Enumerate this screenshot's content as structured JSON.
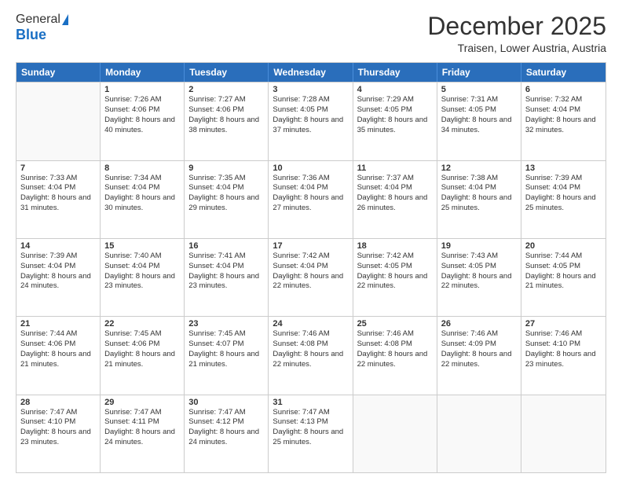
{
  "logo": {
    "general": "General",
    "blue": "Blue"
  },
  "header": {
    "month": "December 2025",
    "location": "Traisen, Lower Austria, Austria"
  },
  "weekdays": [
    "Sunday",
    "Monday",
    "Tuesday",
    "Wednesday",
    "Thursday",
    "Friday",
    "Saturday"
  ],
  "weeks": [
    [
      {
        "day": "",
        "empty": true
      },
      {
        "day": "1",
        "sunrise": "7:26 AM",
        "sunset": "4:06 PM",
        "daylight": "8 hours and 40 minutes."
      },
      {
        "day": "2",
        "sunrise": "7:27 AM",
        "sunset": "4:06 PM",
        "daylight": "8 hours and 38 minutes."
      },
      {
        "day": "3",
        "sunrise": "7:28 AM",
        "sunset": "4:05 PM",
        "daylight": "8 hours and 37 minutes."
      },
      {
        "day": "4",
        "sunrise": "7:29 AM",
        "sunset": "4:05 PM",
        "daylight": "8 hours and 35 minutes."
      },
      {
        "day": "5",
        "sunrise": "7:31 AM",
        "sunset": "4:05 PM",
        "daylight": "8 hours and 34 minutes."
      },
      {
        "day": "6",
        "sunrise": "7:32 AM",
        "sunset": "4:04 PM",
        "daylight": "8 hours and 32 minutes."
      }
    ],
    [
      {
        "day": "7",
        "sunrise": "7:33 AM",
        "sunset": "4:04 PM",
        "daylight": "8 hours and 31 minutes."
      },
      {
        "day": "8",
        "sunrise": "7:34 AM",
        "sunset": "4:04 PM",
        "daylight": "8 hours and 30 minutes."
      },
      {
        "day": "9",
        "sunrise": "7:35 AM",
        "sunset": "4:04 PM",
        "daylight": "8 hours and 29 minutes."
      },
      {
        "day": "10",
        "sunrise": "7:36 AM",
        "sunset": "4:04 PM",
        "daylight": "8 hours and 27 minutes."
      },
      {
        "day": "11",
        "sunrise": "7:37 AM",
        "sunset": "4:04 PM",
        "daylight": "8 hours and 26 minutes."
      },
      {
        "day": "12",
        "sunrise": "7:38 AM",
        "sunset": "4:04 PM",
        "daylight": "8 hours and 25 minutes."
      },
      {
        "day": "13",
        "sunrise": "7:39 AM",
        "sunset": "4:04 PM",
        "daylight": "8 hours and 25 minutes."
      }
    ],
    [
      {
        "day": "14",
        "sunrise": "7:39 AM",
        "sunset": "4:04 PM",
        "daylight": "8 hours and 24 minutes."
      },
      {
        "day": "15",
        "sunrise": "7:40 AM",
        "sunset": "4:04 PM",
        "daylight": "8 hours and 23 minutes."
      },
      {
        "day": "16",
        "sunrise": "7:41 AM",
        "sunset": "4:04 PM",
        "daylight": "8 hours and 23 minutes."
      },
      {
        "day": "17",
        "sunrise": "7:42 AM",
        "sunset": "4:04 PM",
        "daylight": "8 hours and 22 minutes."
      },
      {
        "day": "18",
        "sunrise": "7:42 AM",
        "sunset": "4:05 PM",
        "daylight": "8 hours and 22 minutes."
      },
      {
        "day": "19",
        "sunrise": "7:43 AM",
        "sunset": "4:05 PM",
        "daylight": "8 hours and 22 minutes."
      },
      {
        "day": "20",
        "sunrise": "7:44 AM",
        "sunset": "4:05 PM",
        "daylight": "8 hours and 21 minutes."
      }
    ],
    [
      {
        "day": "21",
        "sunrise": "7:44 AM",
        "sunset": "4:06 PM",
        "daylight": "8 hours and 21 minutes."
      },
      {
        "day": "22",
        "sunrise": "7:45 AM",
        "sunset": "4:06 PM",
        "daylight": "8 hours and 21 minutes."
      },
      {
        "day": "23",
        "sunrise": "7:45 AM",
        "sunset": "4:07 PM",
        "daylight": "8 hours and 21 minutes."
      },
      {
        "day": "24",
        "sunrise": "7:46 AM",
        "sunset": "4:08 PM",
        "daylight": "8 hours and 22 minutes."
      },
      {
        "day": "25",
        "sunrise": "7:46 AM",
        "sunset": "4:08 PM",
        "daylight": "8 hours and 22 minutes."
      },
      {
        "day": "26",
        "sunrise": "7:46 AM",
        "sunset": "4:09 PM",
        "daylight": "8 hours and 22 minutes."
      },
      {
        "day": "27",
        "sunrise": "7:46 AM",
        "sunset": "4:10 PM",
        "daylight": "8 hours and 23 minutes."
      }
    ],
    [
      {
        "day": "28",
        "sunrise": "7:47 AM",
        "sunset": "4:10 PM",
        "daylight": "8 hours and 23 minutes."
      },
      {
        "day": "29",
        "sunrise": "7:47 AM",
        "sunset": "4:11 PM",
        "daylight": "8 hours and 24 minutes."
      },
      {
        "day": "30",
        "sunrise": "7:47 AM",
        "sunset": "4:12 PM",
        "daylight": "8 hours and 24 minutes."
      },
      {
        "day": "31",
        "sunrise": "7:47 AM",
        "sunset": "4:13 PM",
        "daylight": "8 hours and 25 minutes."
      },
      {
        "day": "",
        "empty": true
      },
      {
        "day": "",
        "empty": true
      },
      {
        "day": "",
        "empty": true
      }
    ]
  ]
}
